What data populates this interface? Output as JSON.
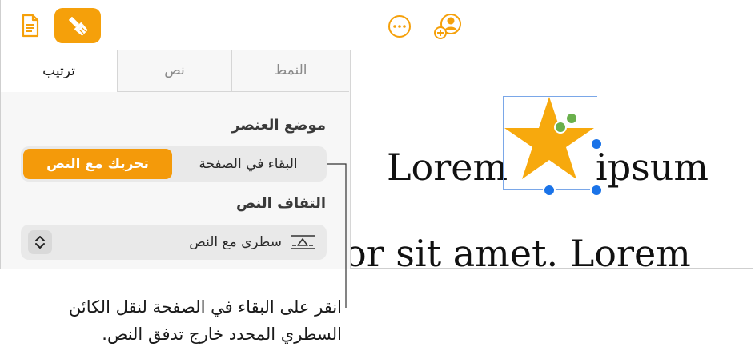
{
  "sidebar": {
    "tabs": [
      {
        "label": "ترتيب"
      },
      {
        "label": "نص"
      },
      {
        "label": "النمط"
      }
    ],
    "object_placement": {
      "title": "موضع العنصر",
      "options": [
        {
          "label": "تحريك مع النص"
        },
        {
          "label": "البقاء في الصفحة"
        }
      ]
    },
    "text_wrap": {
      "title": "التفاف النص",
      "value": "سطري مع النص"
    }
  },
  "canvas": {
    "line1_left": "Lorem",
    "line1_right": "ipsum",
    "line2": "or sit amet. Lorem"
  },
  "caption": {
    "line1": "انقر على البقاء في الصفحة لنقل الكائن",
    "line2": "السطري المحدد خارج تدفق النص."
  },
  "colors": {
    "accent": "#f5a00a",
    "selection": "#1a73e8",
    "rotate_handle": "#6ab04c"
  }
}
